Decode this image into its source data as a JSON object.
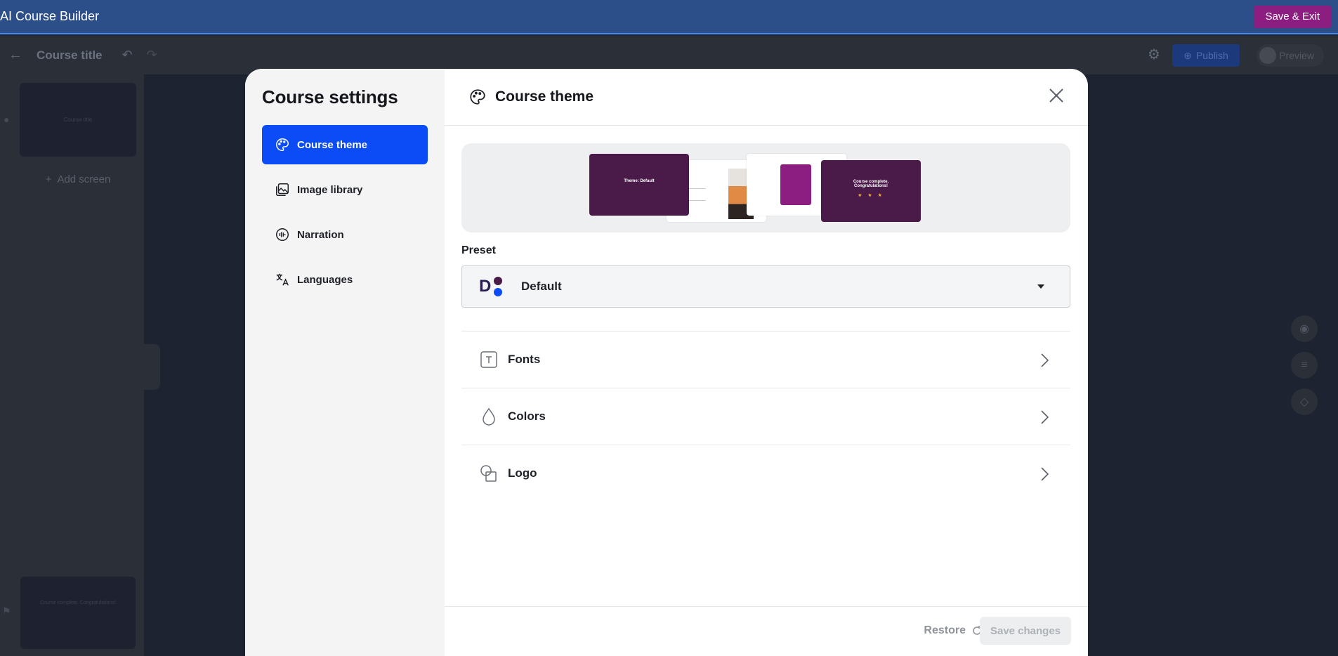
{
  "appbar": {
    "title": "AI Course Builder",
    "save_exit_label": "Save & Exit"
  },
  "editor": {
    "course_title": "Course title",
    "publish_label": "Publish",
    "preview_label": "Preview",
    "add_screen_label": "Add screen",
    "thumb_first": "Course title",
    "thumb_last": "Course complete. Congratulations!"
  },
  "modal": {
    "sidebar_title": "Course settings",
    "nav": [
      {
        "label": "Course theme",
        "icon": "palette-icon",
        "active": true
      },
      {
        "label": "Image library",
        "icon": "image-icon",
        "active": false
      },
      {
        "label": "Narration",
        "icon": "audio-wave-icon",
        "active": false
      },
      {
        "label": "Languages",
        "icon": "translate-icon",
        "active": false
      }
    ],
    "header_title": "Course theme",
    "preview_slides": {
      "slide1_title": "Theme: Default",
      "slide4_title": "Course complete. Congratulations!",
      "stars": "★ ★ ★"
    },
    "preset": {
      "label": "Preset",
      "logo_letter": "D",
      "value": "Default",
      "dot_colors": [
        "#4a1a48",
        "#0b4cf7"
      ]
    },
    "options": [
      {
        "label": "Fonts",
        "icon": "font-icon"
      },
      {
        "label": "Colors",
        "icon": "droplet-icon"
      },
      {
        "label": "Logo",
        "icon": "shapes-icon"
      }
    ],
    "footer": {
      "restore_label": "Restore",
      "save_label": "Save changes"
    }
  },
  "colors": {
    "accent": "#0b4cf7",
    "brand": "#8b1e80",
    "appbar": "#2d4f89"
  }
}
